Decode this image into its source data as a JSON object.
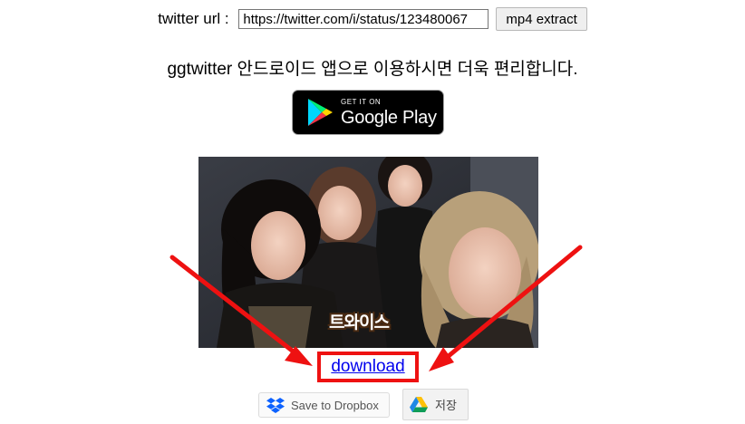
{
  "url_row": {
    "label": "twitter url : ",
    "input_value": "https://twitter.com/i/status/123480067",
    "button_label": "mp4 extract"
  },
  "promo": {
    "text": "ggtwitter 안드로이드 앱으로 이용하시면 더욱 편리합니다."
  },
  "google_play": {
    "small_text": "GET IT ON",
    "big_text": "Google Play",
    "icon": "google-play-icon"
  },
  "video": {
    "caption": "트와이스"
  },
  "download": {
    "link_text": "download",
    "highlight_color": "#ee1111"
  },
  "save_buttons": {
    "dropbox_label": "Save to Dropbox",
    "drive_label": "저장"
  },
  "colors": {
    "link": "#0000ee",
    "arrow": "#ee1111"
  }
}
